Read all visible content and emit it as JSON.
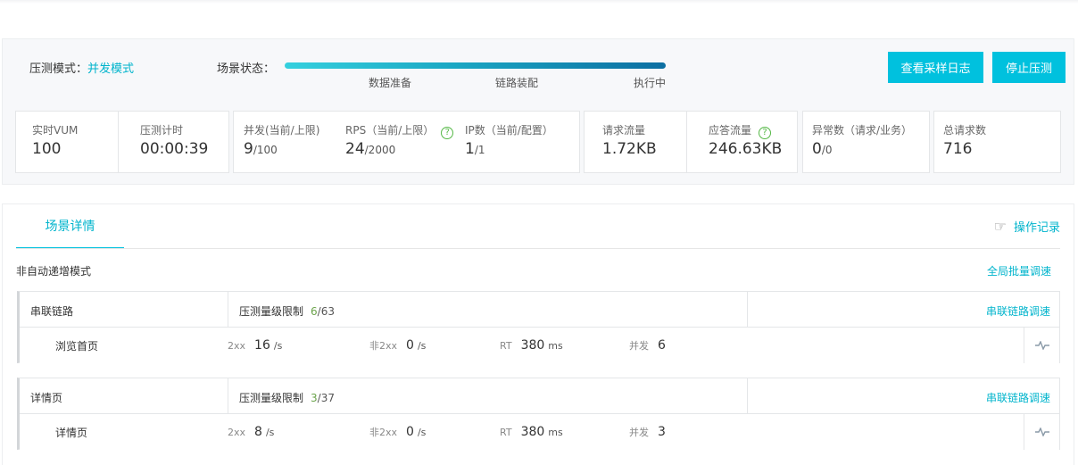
{
  "header": {
    "mode_label": "压测模式：",
    "mode_value": "并发模式",
    "scene_state_label": "场景状态：",
    "stages": [
      "数据准备",
      "链路装配",
      "执行中"
    ],
    "buttons": {
      "view_logs": "查看采样日志",
      "stop": "停止压测"
    }
  },
  "stats": {
    "vum": {
      "label": "实时VUM",
      "value": "100"
    },
    "timer": {
      "label": "压测计时",
      "value": "00:00:39"
    },
    "concurrency": {
      "label": "并发(当前/上限)",
      "current": "9",
      "limit": "/100"
    },
    "rps": {
      "label": "RPS（当前/上限）",
      "current": "24",
      "limit": "/2000"
    },
    "ip": {
      "label": "IP数（当前/配置）",
      "current": "1",
      "limit": "/1"
    },
    "req_traffic": {
      "label": "请求流量",
      "value": "1.72KB"
    },
    "resp_traffic": {
      "label": "应答流量",
      "value": "246.63KB"
    },
    "errors": {
      "label": "异常数（请求/业务）",
      "current": "0",
      "limit": "/0"
    },
    "total": {
      "label": "总请求数",
      "value": "716"
    }
  },
  "detail": {
    "tab": "场景详情",
    "op_log": "操作记录",
    "mode_text": "非自动递增模式",
    "global_adjust": "全局批量调速",
    "chains": [
      {
        "name": "串联链路",
        "limit_label": "压测量级限制",
        "limit_cur": "6",
        "limit_max": "/63",
        "adjust": "串联链路调速",
        "page": "浏览首页",
        "ok_label": "2xx",
        "ok_value": "16",
        "ok_unit": "/s",
        "err_label": "非2xx",
        "err_value": "0",
        "err_unit": "/s",
        "rt_label": "RT",
        "rt_value": "380",
        "rt_unit": "ms",
        "conc_label": "并发",
        "conc_value": "6"
      },
      {
        "name": "详情页",
        "limit_label": "压测量级限制",
        "limit_cur": "3",
        "limit_max": "/37",
        "adjust": "串联链路调速",
        "page": "详情页",
        "ok_label": "2xx",
        "ok_value": "8",
        "ok_unit": "/s",
        "err_label": "非2xx",
        "err_value": "0",
        "err_unit": "/s",
        "rt_label": "RT",
        "rt_value": "380",
        "rt_unit": "ms",
        "conc_label": "并发",
        "conc_value": "3"
      }
    ]
  },
  "icons": {
    "help": "help-circle-icon",
    "hand": "pointing-hand-icon",
    "wave": "pulse-wave-icon"
  },
  "colors": {
    "accent": "#00c1de",
    "link": "#00b4cc",
    "help_green": "#55b846"
  }
}
